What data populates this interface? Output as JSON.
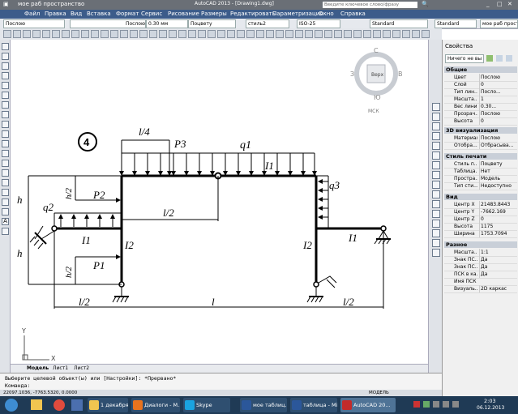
{
  "titlebar": {
    "workspace": "мое раб пространство",
    "title": "AutoCAD 2013 - [Drawing1.dwg]",
    "search_placeholder": "Введите ключевое слово/фразу"
  },
  "menu": [
    "Файл",
    "Правка",
    "Вид",
    "Вставка",
    "Формат",
    "Сервис",
    "Рисование",
    "Размеры",
    "Редактировать",
    "Параметризация",
    "Окно",
    "Справка"
  ],
  "props_toolbar": {
    "layer": "Послою",
    "linetype": "Послою",
    "lineweight": "0.30 мм",
    "plotstyle": "Поцвету",
    "textstyle": "стиль2",
    "dimstyle": "ISO-25",
    "tablestyle": "Standard",
    "mleaderstyle": "Standard",
    "workspace": "мое раб простр"
  },
  "viewcube": {
    "top": "Верх",
    "n": "С",
    "s": "Ю",
    "w": "З",
    "e": "В",
    "wcs": "МСК"
  },
  "drawing": {
    "circle_label": "4",
    "dims": {
      "quarter": "l/4",
      "half_top": "l/2",
      "l": "l",
      "half_left": "l/2",
      "half_right": "l/2",
      "h_upper": "h",
      "h_lower": "h",
      "h_half1": "h/2",
      "h_half2": "h/2"
    },
    "loads": {
      "P3": "P3",
      "q1": "q1",
      "q2": "q2",
      "q3": "q3",
      "P2": "P2",
      "P1": "P1"
    },
    "inertia": {
      "I1_top": "I1",
      "I1_left": "I1",
      "I1_right": "I1",
      "I2_left": "I2",
      "I2_right": "I2"
    }
  },
  "axis": {
    "x": "X",
    "y": "Y"
  },
  "tabs": [
    "Модель",
    "Лист1",
    "Лист2"
  ],
  "command": {
    "line1": "Выберите целевой объект(ы) или [Настройки]: *Прервано*",
    "line2": "Команда:"
  },
  "status": {
    "coords": "22097.1036, -7763.5320, 0.0000",
    "mode": "МОДЕЛЬ"
  },
  "palette": {
    "title": "Свойства",
    "selection": "Ничего не вы",
    "sections": [
      {
        "name": "Общие",
        "rows": [
          [
            "Цвет",
            "Послою"
          ],
          [
            "Слой",
            "0"
          ],
          [
            "Тип лин...",
            "Посло..."
          ],
          [
            "Масшта...",
            "1"
          ],
          [
            "Вес линий",
            "0.30..."
          ],
          [
            "Прозрач...",
            "Послою"
          ],
          [
            "Высота",
            "0"
          ]
        ]
      },
      {
        "name": "3D визуализация",
        "rows": [
          [
            "Материал",
            "Послою"
          ],
          [
            "Отобра...",
            "Отбрасыва..."
          ]
        ]
      },
      {
        "name": "Стиль печати",
        "rows": [
          [
            "Стиль п...",
            "Поцвету"
          ],
          [
            "Таблица...",
            "Нет"
          ],
          [
            "Простра...",
            "Модель"
          ],
          [
            "Тип сти...",
            "Недоступно"
          ]
        ]
      },
      {
        "name": "Вид",
        "rows": [
          [
            "Центр X",
            "21483.8443"
          ],
          [
            "Центр Y",
            "-7662.169"
          ],
          [
            "Центр Z",
            "0"
          ],
          [
            "Высота",
            "1175"
          ],
          [
            "Ширина",
            "1753.7094"
          ]
        ]
      },
      {
        "name": "Разное",
        "rows": [
          [
            "Масшта...",
            "1:1"
          ],
          [
            "Знак ПС...",
            "Да"
          ],
          [
            "Знак ПС...",
            "Да"
          ],
          [
            "ПСК в ка...",
            "Да"
          ],
          [
            "Имя ПСК",
            ""
          ],
          [
            "Визуаль...",
            "2D каркас"
          ]
        ]
      }
    ]
  },
  "taskbar": {
    "items": [
      "1 декабря",
      "Диалоги - M...",
      "Skype",
      "мое таблиц...",
      "таблица - Mi...",
      "AutoCAD 20..."
    ],
    "time": "2:03",
    "date": "06.12.2013"
  },
  "colors": {
    "menubar": "#3c5c8a",
    "taskbar": "#1f3a55",
    "titlebar": "#6a6f76"
  }
}
